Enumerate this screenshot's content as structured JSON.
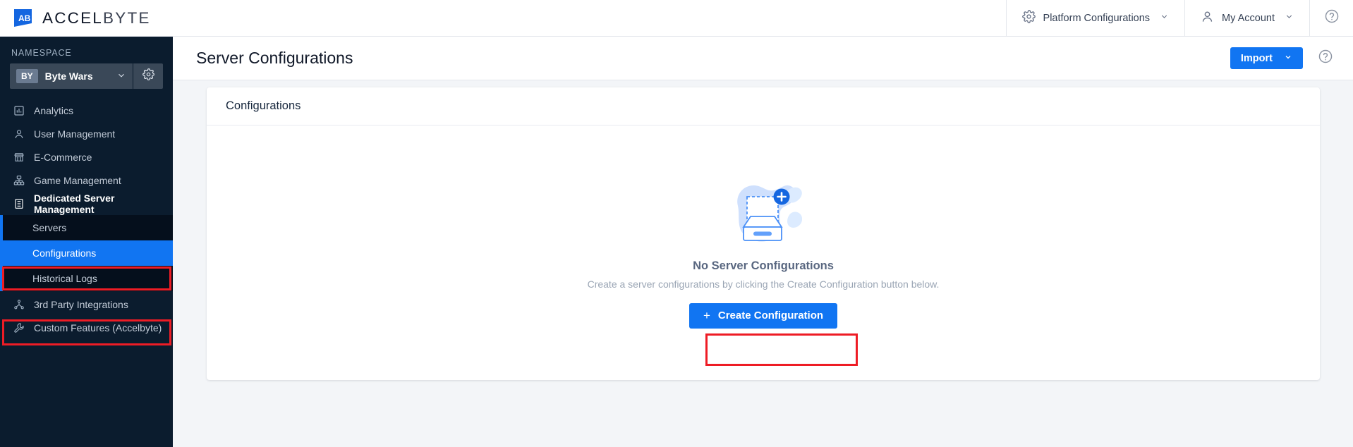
{
  "brand": {
    "logo_icon": "accelbyte-logo-icon",
    "name_part1": "ACCEL",
    "name_part2": "BYTE"
  },
  "topbar": {
    "platform_configurations": "Platform Configurations",
    "platform_configurations_icon": "gear-icon",
    "my_account": "My Account",
    "my_account_icon": "user-icon",
    "chevron_icon": "chevron-down-icon",
    "help_icon": "help-circle-icon"
  },
  "sidebar": {
    "namespace_label": "NAMESPACE",
    "namespace": {
      "badge": "BY",
      "name": "Byte Wars",
      "chevron_icon": "chevron-down-icon",
      "settings_icon": "gear-icon"
    },
    "items": [
      {
        "label": "Analytics",
        "icon": "chart-bar-icon"
      },
      {
        "label": "User Management",
        "icon": "user-icon"
      },
      {
        "label": "E-Commerce",
        "icon": "store-icon"
      },
      {
        "label": "Game Management",
        "icon": "sitemap-icon"
      },
      {
        "label": "Dedicated Server Management",
        "icon": "server-icon"
      }
    ],
    "submenu": [
      {
        "label": "Servers"
      },
      {
        "label": "Configurations"
      },
      {
        "label": "Historical Logs"
      }
    ],
    "items_bottom": [
      {
        "label": "3rd Party Integrations",
        "icon": "network-nodes-icon"
      },
      {
        "label": "Custom Features (Accelbyte)",
        "icon": "wrench-icon"
      }
    ]
  },
  "page": {
    "title": "Server Configurations",
    "import_label": "Import",
    "import_chevron_icon": "chevron-down-icon",
    "help_icon": "help-circle-icon"
  },
  "card": {
    "title": "Configurations",
    "empty_state": {
      "illustration": "empty-inbox-add-icon",
      "title": "No Server Configurations",
      "subtitle": "Create a server configurations by clicking the Create Configuration button below.",
      "button_label": "Create Configuration",
      "button_icon": "plus-icon"
    }
  },
  "colors": {
    "accent_blue": "#1175f2",
    "sidebar_bg": "#0b1c2e",
    "submenu_bg": "#050f1c",
    "highlight_red": "#ee1c25",
    "page_bg": "#f3f5f8"
  }
}
